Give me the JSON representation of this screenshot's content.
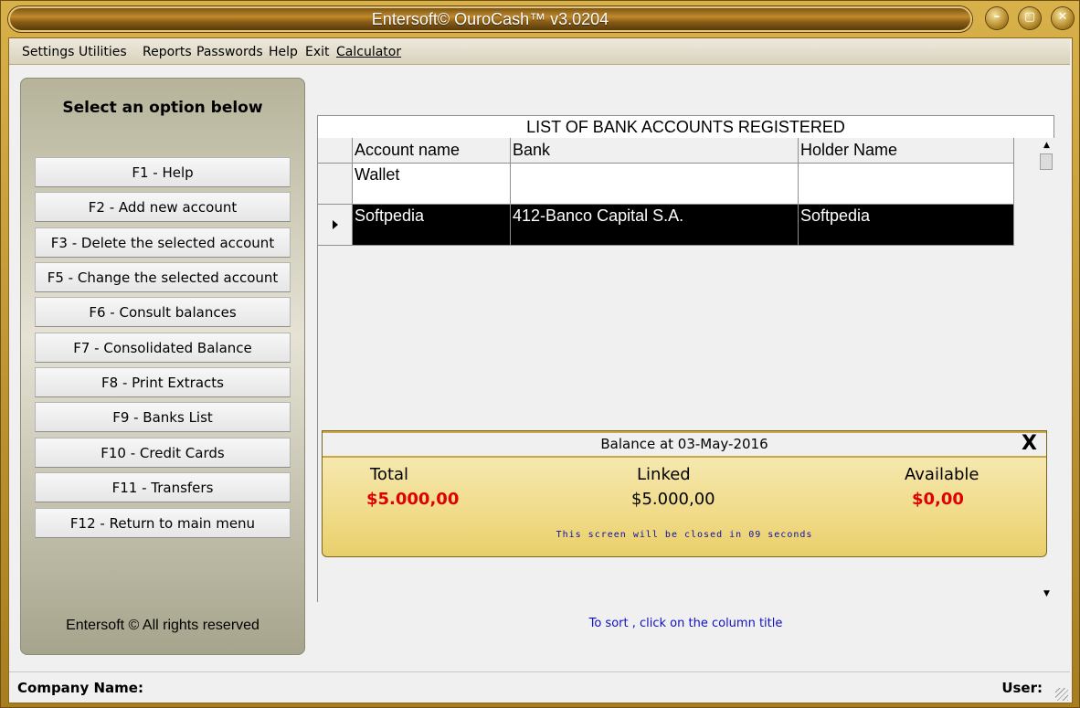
{
  "window": {
    "title": "Entersoft© OuroCash™ v3.0204",
    "buttons": [
      "minimize",
      "restore",
      "close"
    ]
  },
  "menubar": {
    "items": [
      "Settings",
      "Utilities",
      "Reports",
      "Passwords",
      "Help",
      "Exit",
      "Calculator"
    ]
  },
  "sidebar": {
    "heading": "Select an option below",
    "items": [
      {
        "label": "F1 - Help"
      },
      {
        "label": "F2 - Add new account"
      },
      {
        "label": "F3 - Delete the selected account"
      },
      {
        "label": "F5 - Change the selected account"
      },
      {
        "label": "F6 - Consult balances"
      },
      {
        "label": "F7 - Consolidated Balance"
      },
      {
        "label": "F8 - Print Extracts"
      },
      {
        "label": "F9 - Banks List"
      },
      {
        "label": "F10 - Credit Cards"
      },
      {
        "label": "F11 - Transfers"
      },
      {
        "label": "F12 - Return to main menu"
      }
    ],
    "footer": "Entersoft © All rights reserved"
  },
  "grid": {
    "caption": "LIST OF BANK ACCOUNTS REGISTERED",
    "columns": [
      "Account name",
      "Bank",
      "Holder Name"
    ],
    "rows": [
      {
        "account": "Wallet",
        "bank": "",
        "holder": "",
        "selected": false
      },
      {
        "account": "Softpedia",
        "bank": "412-Banco Capital S.A.",
        "holder": "Softpedia",
        "selected": true
      }
    ]
  },
  "balance": {
    "title": "Balance at 03-May-2016",
    "close_label": "X",
    "total_label": "Total",
    "total_value": "$5.000,00",
    "linked_label": "Linked",
    "linked_value": "$5.000,00",
    "available_label": "Available",
    "available_value": "$0,00",
    "note": "This screen will be closed in 09 seconds"
  },
  "sort_hint": "To sort , click on the column title",
  "status": {
    "company_label": "Company Name:",
    "user_label": "User:"
  },
  "colors": {
    "accent_gold": "#d9b14a",
    "value_red": "#e00000",
    "hint_blue": "#1010c0"
  }
}
